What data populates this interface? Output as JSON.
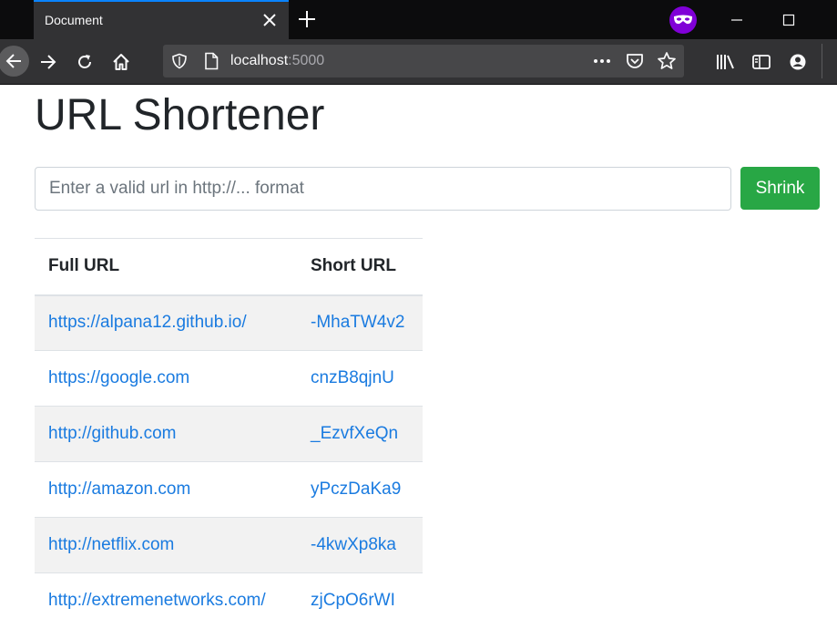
{
  "browser": {
    "tab": {
      "title": "Document",
      "close_icon": "close-icon"
    },
    "newtab_icon": "plus-icon",
    "private_icon": "private-mask-icon",
    "address": {
      "host": "localhost",
      "port": ":5000"
    },
    "nav_icons": [
      "back-arrow-icon",
      "forward-arrow-icon",
      "reload-icon",
      "home-icon"
    ],
    "toolbar_icons": [
      "library-icon",
      "sidebar-icon",
      "account-icon"
    ],
    "accent_color": "#0a84ff"
  },
  "page": {
    "title": "URL Shortener",
    "input": {
      "placeholder": "Enter a valid url in http://... format",
      "value": ""
    },
    "shrink_label": "Shrink",
    "shrink_color": "#28a745",
    "table": {
      "headers": {
        "full": "Full URL",
        "short": "Short URL"
      },
      "rows": [
        {
          "full": "https://alpana12.github.io/",
          "short": "-MhaTW4v2"
        },
        {
          "full": "https://google.com",
          "short": "cnzB8qjnU"
        },
        {
          "full": "http://github.com",
          "short": "_EzvfXeQn"
        },
        {
          "full": "http://amazon.com",
          "short": "yPczDaKa9"
        },
        {
          "full": "http://netflix.com",
          "short": "-4kwXp8ka"
        },
        {
          "full": "http://extremenetworks.com/",
          "short": "zjCpO6rWI"
        }
      ]
    },
    "link_color": "#1a7be0"
  }
}
